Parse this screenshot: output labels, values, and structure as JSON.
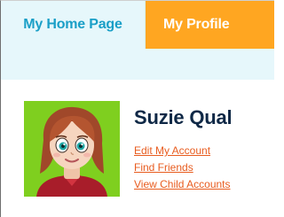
{
  "tabs": {
    "home_label": "My Home Page",
    "profile_label": "My Profile"
  },
  "profile": {
    "name": "Suzie Qual",
    "links": [
      "Edit My Account",
      "Find Friends",
      "View Child Accounts"
    ]
  },
  "colors": {
    "active_tab_bg": "#e6f7fb",
    "active_tab_text": "#1a9fc7",
    "profile_tab_bg": "#ffa621",
    "avatar_bg": "#7fcf1f",
    "link": "#e85c1f",
    "name": "#0f2846"
  },
  "icons": {
    "avatar": "girl-avatar-icon"
  }
}
